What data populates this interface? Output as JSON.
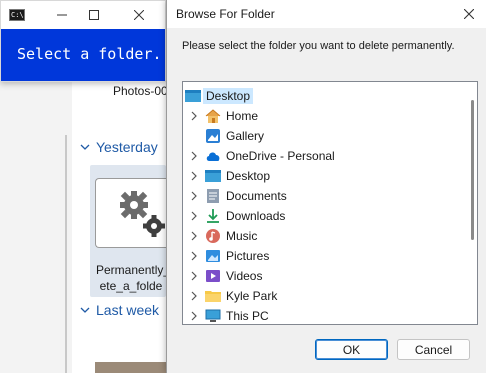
{
  "explorer": {
    "photo_label": "Photos-00",
    "groups": {
      "yesterday": "Yesterday",
      "last_week": "Last week"
    },
    "item": {
      "name_line1": "Permanently_",
      "name_line2": "ete_a_folde"
    }
  },
  "console": {
    "icon_text": "C:\\.",
    "message": "Select a folder."
  },
  "dialog": {
    "title": "Browse For Folder",
    "prompt": "Please select the folder you want to delete permanently.",
    "tree": [
      {
        "label": "Desktop",
        "icon": "desktop-blue-icon",
        "root": true
      },
      {
        "label": "Home",
        "icon": "home-icon"
      },
      {
        "label": "Gallery",
        "icon": "gallery-icon"
      },
      {
        "label": "OneDrive - Personal",
        "icon": "onedrive-cloud-icon"
      },
      {
        "label": "Desktop",
        "icon": "desktop-folder-icon"
      },
      {
        "label": "Documents",
        "icon": "documents-icon"
      },
      {
        "label": "Downloads",
        "icon": "downloads-icon"
      },
      {
        "label": "Music",
        "icon": "music-icon"
      },
      {
        "label": "Pictures",
        "icon": "pictures-icon"
      },
      {
        "label": "Videos",
        "icon": "videos-icon"
      },
      {
        "label": "Kyle Park",
        "icon": "user-folder-icon"
      },
      {
        "label": "This PC",
        "icon": "this-pc-icon"
      }
    ],
    "ok_label": "OK",
    "cancel_label": "Cancel"
  },
  "colors": {
    "console_bg": "#0037da",
    "selection": "#cce8ff",
    "accent": "#0067c0",
    "group_header": "#1f5aa6"
  }
}
